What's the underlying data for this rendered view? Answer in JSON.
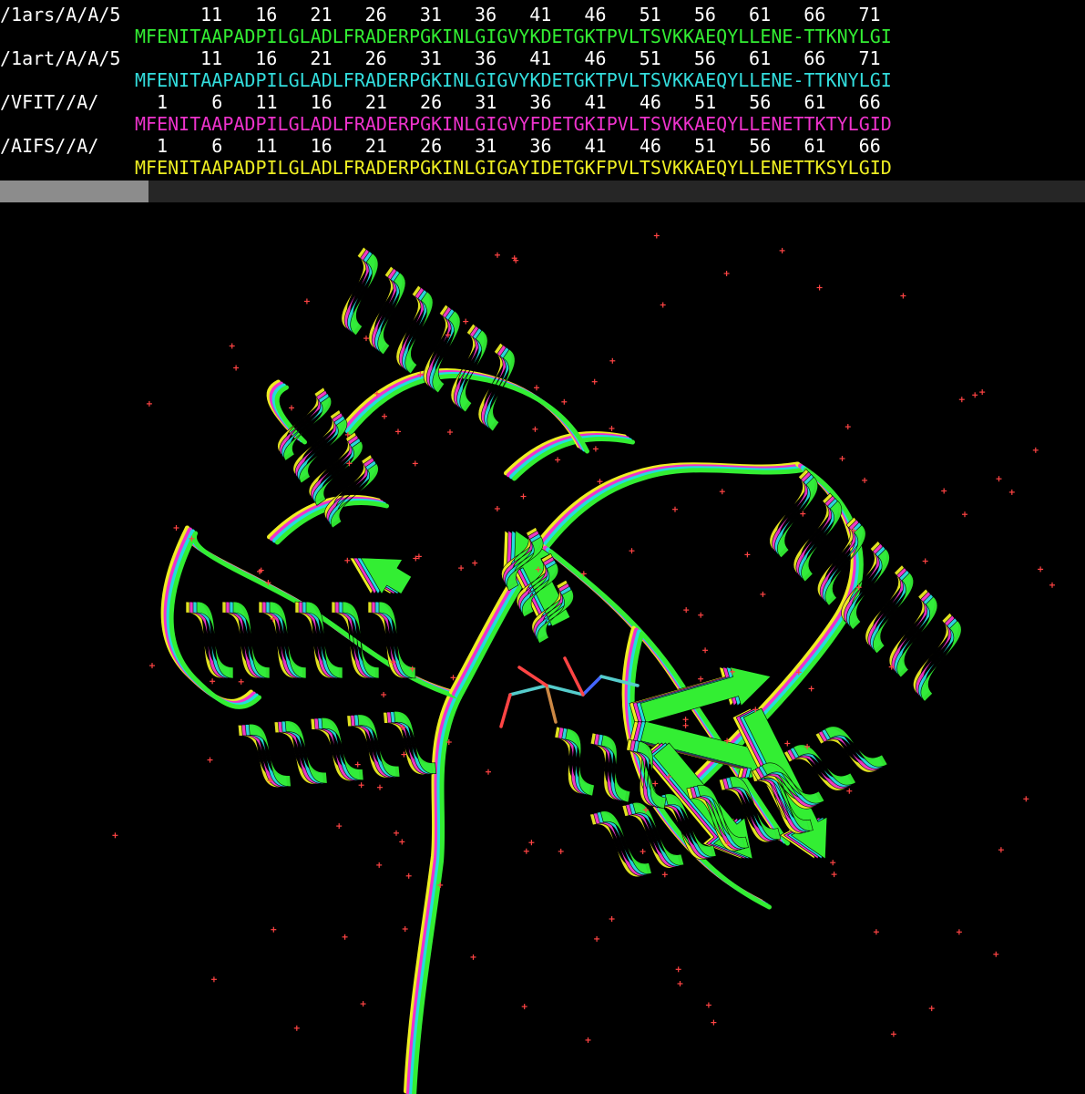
{
  "sequence_viewer": {
    "tracks": [
      {
        "label": "/1ars/A/A/5",
        "numbers": "11   16   21   26   31   36   41   46   51   56   61   66   71",
        "sequence": "MFENITAAPADPILGLADLFRADERPGKINLGIGVYKDETGKTPVLTSVKKAEQYLLENE-TTKNYLGI",
        "color": "#33ee33"
      },
      {
        "label": "/1art/A/A/5",
        "numbers": "11   16   21   26   31   36   41   46   51   56   61   66   71",
        "sequence": "MFENITAAPADPILGLADLFRADERPGKINLGIGVYKDETGKTPVLTSVKKAEQYLLENE-TTKNYLGI",
        "color": "#33dddd"
      },
      {
        "label": "/VFIT//A/",
        "numbers": " 1    6   11   16   21   26   31   36   41   46   51   56   61   66",
        "sequence": "MFENITAAPADPILGLADLFRADERPGKINLGIGVYFDETGKIPVLTSVKKAEQYLLENETTKTYLGID",
        "color": "#ee33cc"
      },
      {
        "label": "/AIFS//A/",
        "numbers": " 1    6   11   16   21   26   31   36   41   46   51   56   61   66",
        "sequence": "MFENITAAPADPILGLADLFRADERPGKINLGIGAYIDETGKFPVLTSVKKAEQYLLENETTKSYLGID",
        "color": "#eeee22"
      }
    ]
  },
  "colors": {
    "background": "#000000",
    "header_text": "#ffffff",
    "chain_green": "#33ee33",
    "chain_cyan": "#22dddd",
    "chain_magenta": "#ee33cc",
    "chain_yellow": "#eeee22",
    "water": "#ff4444"
  }
}
